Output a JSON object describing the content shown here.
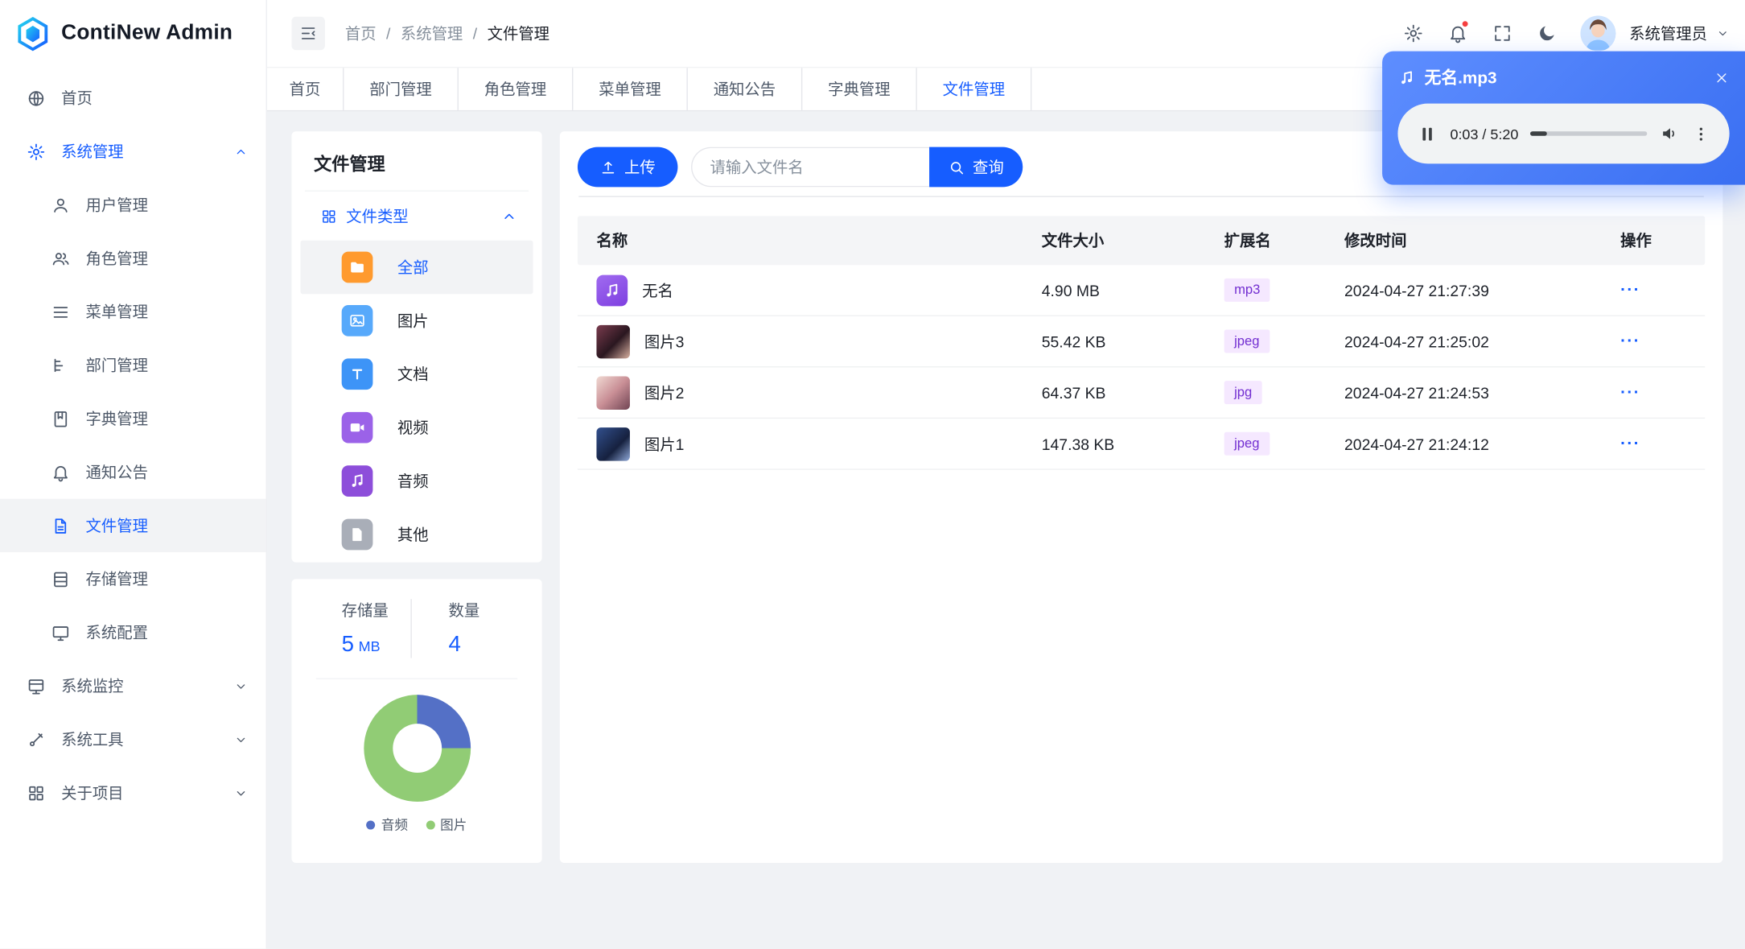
{
  "app": {
    "name": "ContiNew Admin"
  },
  "header": {
    "breadcrumbs": [
      "首页",
      "系统管理",
      "文件管理"
    ],
    "user": {
      "name": "系统管理员"
    }
  },
  "tabs": {
    "items": [
      "首页",
      "部门管理",
      "角色管理",
      "菜单管理",
      "通知公告",
      "字典管理",
      "文件管理"
    ],
    "active": "文件管理"
  },
  "sidebar": {
    "items": [
      {
        "label": "首页",
        "icon": "home-icon",
        "type": "top"
      },
      {
        "label": "系统管理",
        "icon": "settings-icon",
        "type": "group",
        "expanded": true,
        "active": true,
        "children": [
          {
            "label": "用户管理",
            "icon": "user-icon"
          },
          {
            "label": "角色管理",
            "icon": "users-icon"
          },
          {
            "label": "菜单管理",
            "icon": "menu-list-icon"
          },
          {
            "label": "部门管理",
            "icon": "tree-icon"
          },
          {
            "label": "字典管理",
            "icon": "book-icon"
          },
          {
            "label": "通知公告",
            "icon": "bell-icon"
          },
          {
            "label": "文件管理",
            "icon": "file-icon",
            "active": true
          },
          {
            "label": "存储管理",
            "icon": "storage-icon"
          },
          {
            "label": "系统配置",
            "icon": "desktop-icon"
          }
        ]
      },
      {
        "label": "系统监控",
        "icon": "monitor-icon",
        "type": "group",
        "expanded": false
      },
      {
        "label": "系统工具",
        "icon": "wrench-icon",
        "type": "group",
        "expanded": false
      },
      {
        "label": "关于项目",
        "icon": "grid-icon",
        "type": "group",
        "expanded": false
      }
    ]
  },
  "file_panel": {
    "title": "文件管理",
    "group": {
      "label": "文件类型",
      "expanded": true
    },
    "types": [
      {
        "label": "全部",
        "icon": "folder-icon",
        "color": "#FF9A2E",
        "active": true
      },
      {
        "label": "图片",
        "icon": "image-icon",
        "color": "#57A9FB"
      },
      {
        "label": "文档",
        "icon": "text-icon",
        "color": "#3D94F7"
      },
      {
        "label": "视频",
        "icon": "video-icon",
        "color": "#9B62E8"
      },
      {
        "label": "音频",
        "icon": "music-icon",
        "color": "#8D4EDA"
      },
      {
        "label": "其他",
        "icon": "file-other-icon",
        "color": "#A9AEB8"
      }
    ],
    "stats": {
      "storage": {
        "label": "存储量",
        "value": "5",
        "unit": "MB"
      },
      "count": {
        "label": "数量",
        "value": "4"
      }
    }
  },
  "toolbar": {
    "upload_label": "上传",
    "search_placeholder": "请输入文件名",
    "search_value": "",
    "query_label": "查询"
  },
  "files_table": {
    "columns": [
      "名称",
      "文件大小",
      "扩展名",
      "修改时间",
      "操作"
    ],
    "rows": [
      {
        "name": "无名",
        "icon": "audio-file-icon",
        "size": "4.90 MB",
        "ext": "mp3",
        "time": "2024-04-27 21:27:39"
      },
      {
        "name": "图片3",
        "icon": "image-thumbnail",
        "thumb": "a",
        "size": "55.42 KB",
        "ext": "jpeg",
        "time": "2024-04-27 21:25:02"
      },
      {
        "name": "图片2",
        "icon": "image-thumbnail",
        "thumb": "b",
        "size": "64.37 KB",
        "ext": "jpg",
        "time": "2024-04-27 21:24:53"
      },
      {
        "name": "图片1",
        "icon": "image-thumbnail",
        "thumb": "c",
        "size": "147.38 KB",
        "ext": "jpeg",
        "time": "2024-04-27 21:24:12"
      }
    ]
  },
  "audio_player": {
    "filename": "无名.mp3",
    "current_time": "0:03",
    "duration": "5:20",
    "time_display": "0:03 / 5:20",
    "progress_percent": 14
  },
  "chart_data": {
    "type": "pie",
    "donut": true,
    "title": "",
    "labels": [
      "音频",
      "图片"
    ],
    "values": [
      1,
      3
    ],
    "colors": [
      "#5470C6",
      "#91CC75"
    ],
    "legend_position": "bottom"
  },
  "colors": {
    "primary": "#165DFF",
    "tag_bg": "#F5E8FF",
    "tag_text": "#722ED1",
    "notification_dot": "#F53F3F"
  }
}
